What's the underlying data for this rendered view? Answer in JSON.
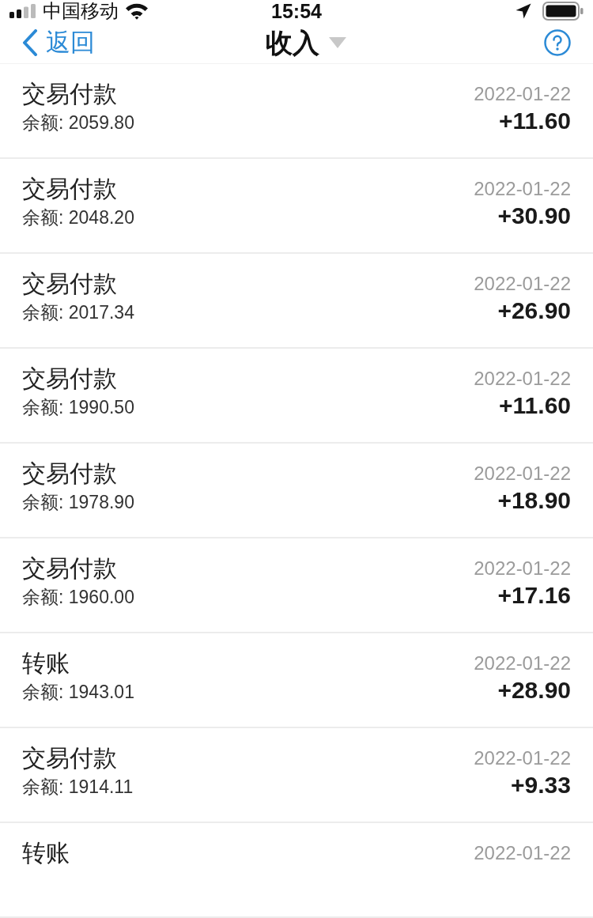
{
  "status_bar": {
    "carrier": "中国移动",
    "time": "15:54"
  },
  "nav": {
    "back": "返回",
    "title": "收入"
  },
  "rows": [
    {
      "title": "交易付款",
      "balance": "余额: 2059.80",
      "date": "2022-01-22",
      "amount": "+11.60"
    },
    {
      "title": "交易付款",
      "balance": "余额: 2048.20",
      "date": "2022-01-22",
      "amount": "+30.90"
    },
    {
      "title": "交易付款",
      "balance": "余额: 2017.34",
      "date": "2022-01-22",
      "amount": "+26.90"
    },
    {
      "title": "交易付款",
      "balance": "余额: 1990.50",
      "date": "2022-01-22",
      "amount": "+11.60"
    },
    {
      "title": "交易付款",
      "balance": "余额: 1978.90",
      "date": "2022-01-22",
      "amount": "+18.90"
    },
    {
      "title": "交易付款",
      "balance": "余额: 1960.00",
      "date": "2022-01-22",
      "amount": "+17.16"
    },
    {
      "title": "转账",
      "balance": "余额: 1943.01",
      "date": "2022-01-22",
      "amount": "+28.90"
    },
    {
      "title": "交易付款",
      "balance": "余额: 1914.11",
      "date": "2022-01-22",
      "amount": "+9.33"
    },
    {
      "title": "转账",
      "date": "2022-01-22"
    }
  ]
}
